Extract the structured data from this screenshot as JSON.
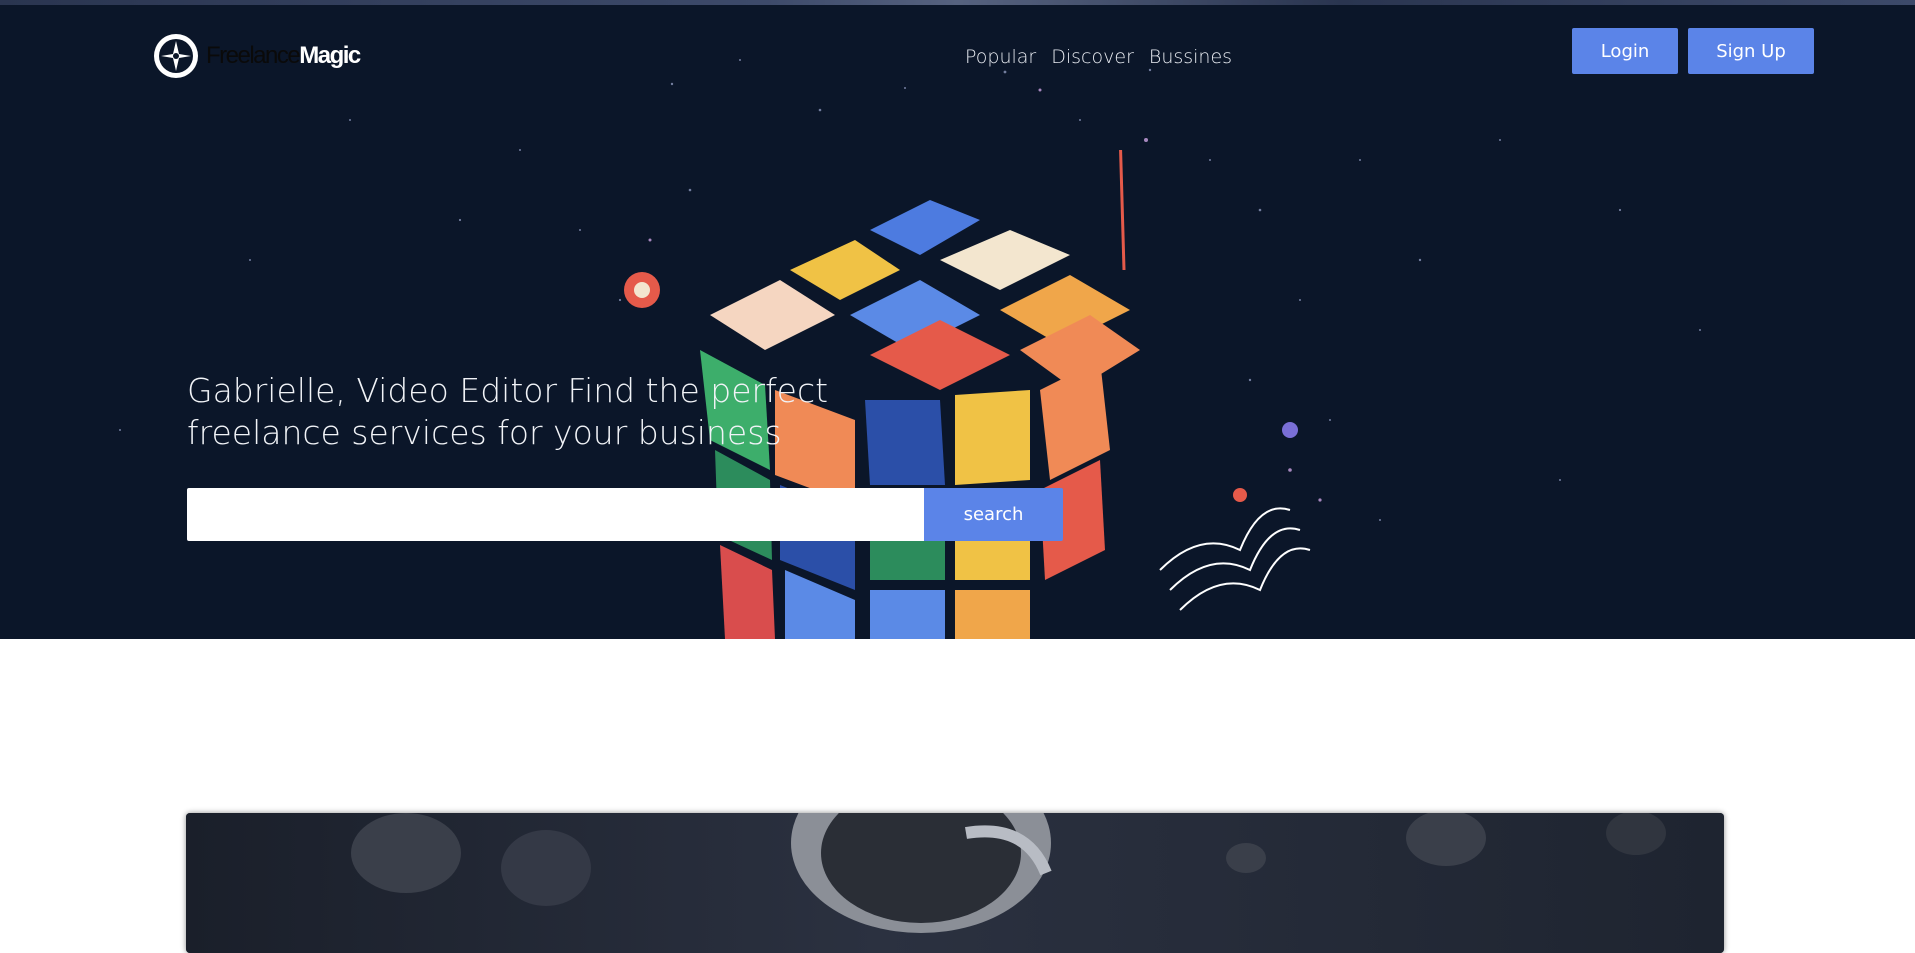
{
  "logo": {
    "word1": "Freelance",
    "word2": "Magic",
    "icon": "compass-logo-icon"
  },
  "nav": {
    "items": [
      {
        "label": "Popular"
      },
      {
        "label": "Discover"
      },
      {
        "label": "Bussines"
      }
    ]
  },
  "auth": {
    "login_label": "Login",
    "signup_label": "Sign Up"
  },
  "hero": {
    "headline_line1": "Gabrielle, Video Editor Find the perfect",
    "headline_line2": "freelance services for your business",
    "illustration": "rubiks-cube-illustration"
  },
  "search": {
    "value": "",
    "placeholder": "",
    "button_label": "search"
  },
  "card": {
    "image": "astronaut-banner-image"
  },
  "colors": {
    "hero_bg": "#0b1629",
    "accent": "#5b84e8",
    "nav_text": "#e9ecf2"
  }
}
